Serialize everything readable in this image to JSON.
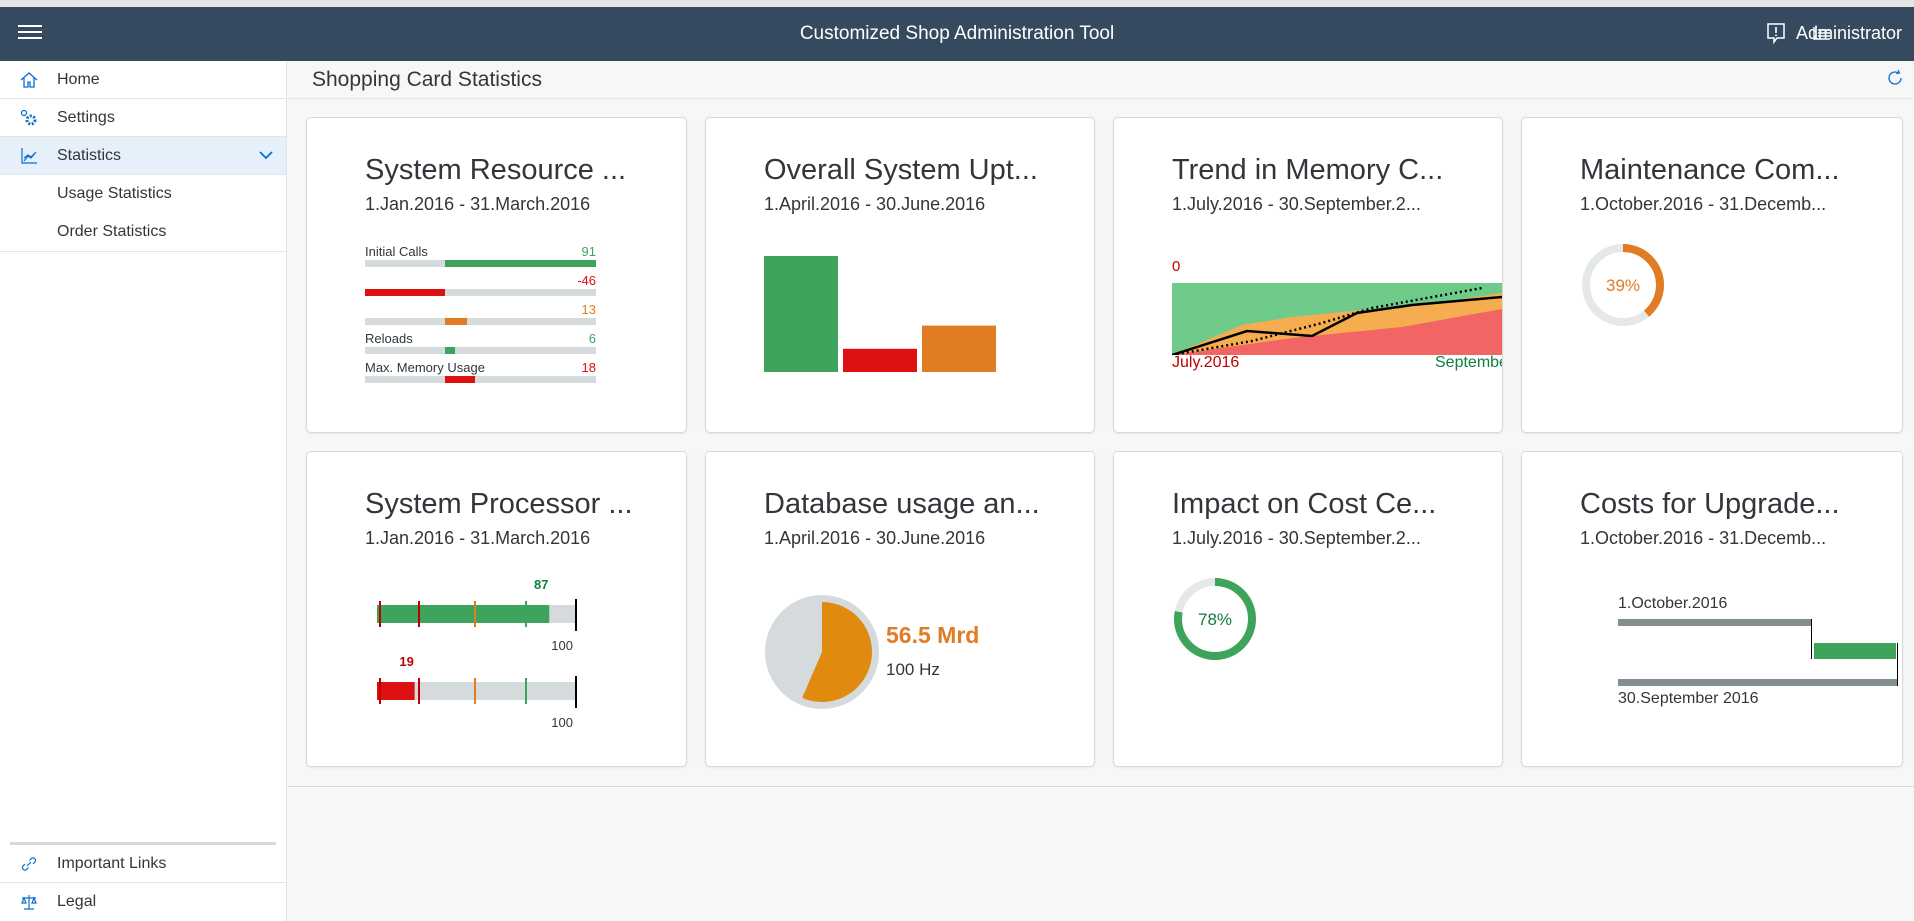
{
  "shell": {
    "title": "Customized Shop Administration Tool",
    "user": "Administrator",
    "icons": [
      "menu-icon",
      "notification-icon",
      "list-icon"
    ]
  },
  "sidebar": {
    "items": [
      {
        "label": "Home",
        "icon": "home-icon"
      },
      {
        "label": "Settings",
        "icon": "settings-icon"
      },
      {
        "label": "Statistics",
        "icon": "chart-icon",
        "selected": true,
        "expanded": true
      }
    ],
    "sub_items": [
      {
        "label": "Usage Statistics"
      },
      {
        "label": "Order Statistics"
      }
    ],
    "footer_items": [
      {
        "label": "Important Links",
        "icon": "link-icon"
      },
      {
        "label": "Legal",
        "icon": "scales-icon"
      }
    ]
  },
  "page": {
    "title": "Shopping Card Statistics",
    "refresh_icon": "refresh-icon"
  },
  "colors": {
    "good": "#3fa45b",
    "critical": "#e17b24",
    "error": "#dd1111",
    "neutral": "#d5dadd",
    "trend_green": "#6fcb8a",
    "trend_orange": "#f5ad4f",
    "trend_red": "#f26565",
    "shell": "#354a5f",
    "accent": "#0a6ed1"
  },
  "cards": [
    {
      "title": "System Resource ...",
      "subtitle": "1.Jan.2016 - 31.March.2016",
      "type": "comparison-bars",
      "rows": [
        {
          "label": "Initial Calls",
          "value": "91",
          "color": "good"
        },
        {
          "label": "",
          "value": "-46",
          "color": "error"
        },
        {
          "label": "",
          "value": "13",
          "color": "critical"
        },
        {
          "label": "Reloads",
          "value": "6",
          "color": "good"
        },
        {
          "label": "Max. Memory Usage",
          "value": "18",
          "color": "error"
        }
      ]
    },
    {
      "title": "Overall System Upt...",
      "subtitle": "1.April.2016 - 30.June.2016",
      "type": "column",
      "columns": [
        {
          "value": 100,
          "color": "good"
        },
        {
          "value": 20,
          "color": "error"
        },
        {
          "value": 40,
          "color": "critical"
        }
      ]
    },
    {
      "title": "Trend in Memory C...",
      "subtitle": "1.July.2016 - 30.September.2...",
      "type": "area",
      "min_label": "0",
      "start_label": "July.2016",
      "end_label": "Septembe"
    },
    {
      "title": "Maintenance Com...",
      "subtitle": "1.October.2016 - 31.Decemb...",
      "type": "radial",
      "percent": 39,
      "label": "39%",
      "color": "critical"
    },
    {
      "title": "System Processor ...",
      "subtitle": "1.Jan.2016 - 31.March.2016",
      "type": "bullet",
      "bullets": [
        {
          "value": 87,
          "label": "87",
          "target_label": "100",
          "color": "good"
        },
        {
          "value": 19,
          "label": "19",
          "target_label": "100",
          "color": "error"
        }
      ]
    },
    {
      "title": "Database usage an...",
      "subtitle": "1.April.2016 - 30.June.2016",
      "type": "harvey",
      "fraction": 0.565,
      "value": "56.5 Mrd",
      "total": "100 Hz"
    },
    {
      "title": "Impact on Cost Ce...",
      "subtitle": "1.July.2016 - 30.September.2...",
      "type": "radial",
      "percent": 78,
      "label": "78%",
      "color": "good"
    },
    {
      "title": "Costs for Upgrade...",
      "subtitle": "1.October.2016 - 31.Decemb...",
      "type": "delta",
      "top_label": "1.October.2016",
      "bottom_label": "30.September 2016"
    }
  ]
}
